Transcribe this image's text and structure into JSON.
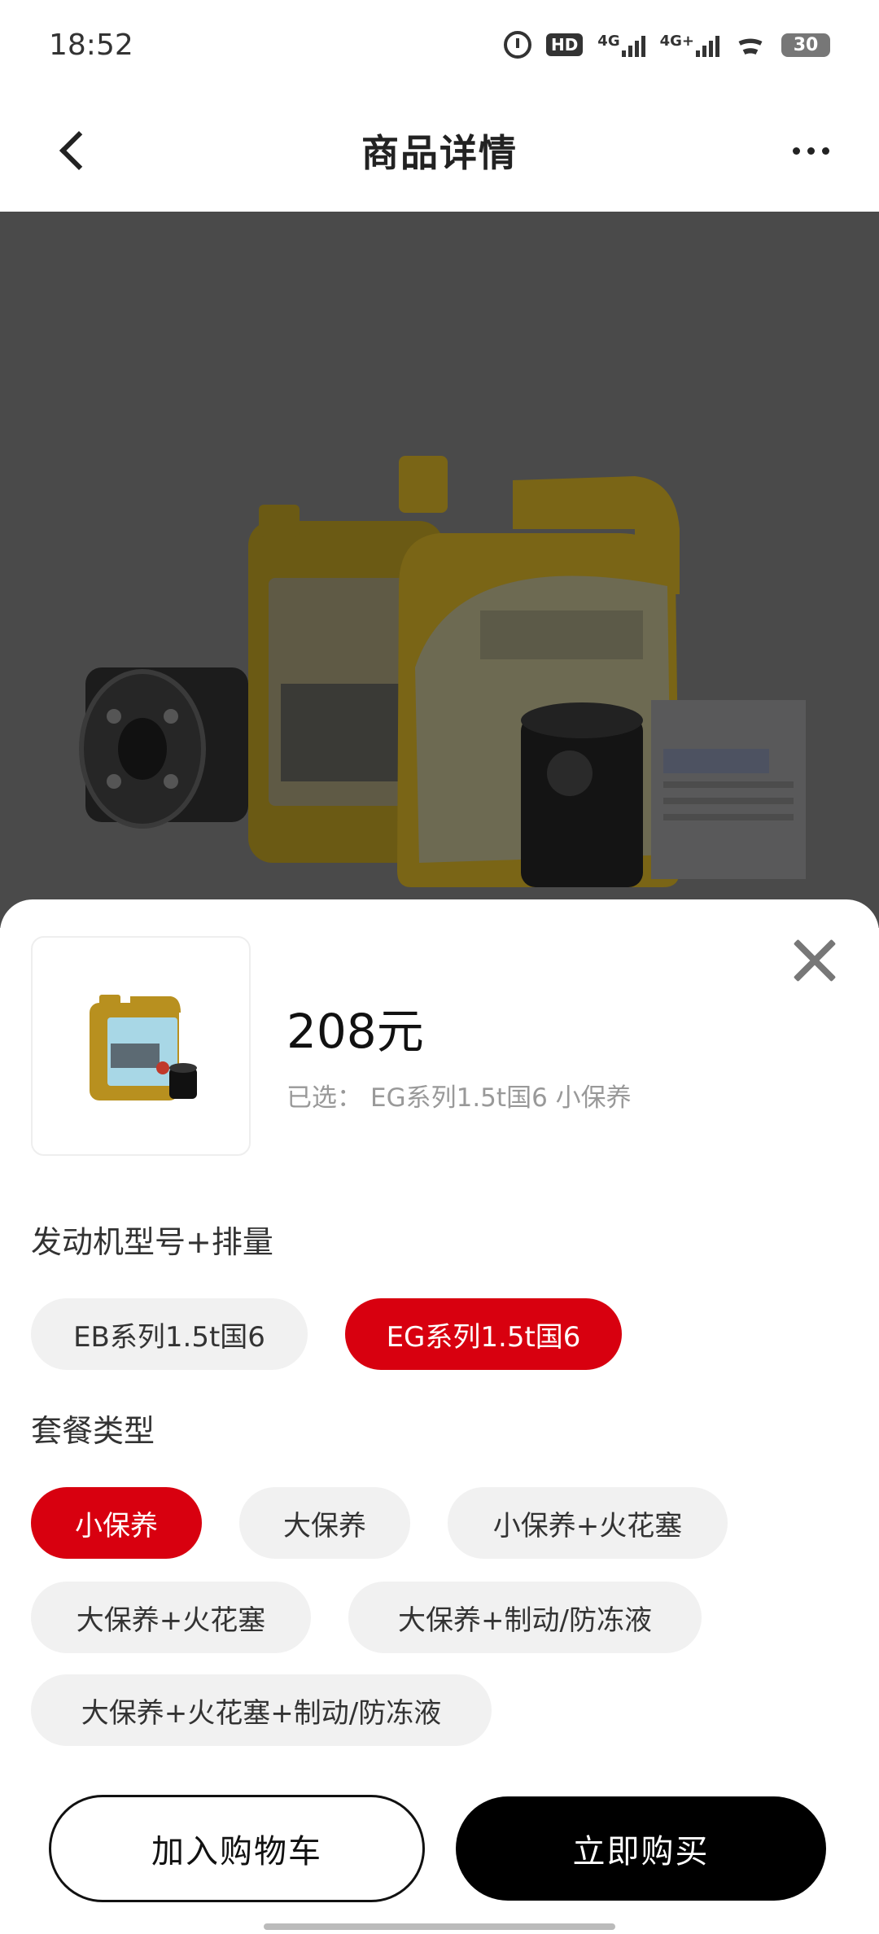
{
  "status_bar": {
    "time": "18:52",
    "hd_label": "HD",
    "sig1_label": "4G",
    "sig2_label": "4G+",
    "battery": "30"
  },
  "header": {
    "title": "商品详情"
  },
  "sheet": {
    "price": "208元",
    "selected_label": "已选：",
    "selected_value": "EG系列1.5t国6 小保养",
    "engine_section": {
      "title": "发动机型号+排量",
      "options": [
        "EB系列1.5t国6",
        "EG系列1.5t国6"
      ],
      "selected": "EG系列1.5t国6"
    },
    "package_section": {
      "title": "套餐类型",
      "options": [
        "小保养",
        "大保养",
        "小保养+火花塞",
        "大保养+火花塞",
        "大保养+制动/防冻液",
        "大保养+火花塞+制动/防冻液"
      ],
      "selected": "小保养"
    }
  },
  "actions": {
    "add_to_cart": "加入购物车",
    "buy_now": "立即购买"
  },
  "colors": {
    "accent": "#d8000f",
    "primary_button": "#000000"
  }
}
